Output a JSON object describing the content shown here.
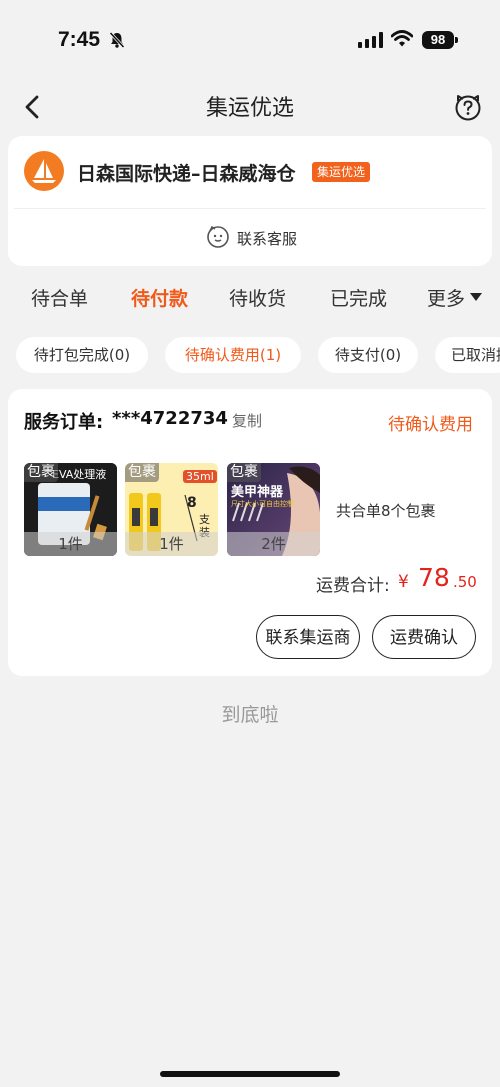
{
  "status_bar": {
    "time": "7:45",
    "battery": "98"
  },
  "nav": {
    "title": "集运优选"
  },
  "store": {
    "name": "日森国际快递–日森威海仓",
    "badge": "集运优选",
    "contact_label": "联系客服"
  },
  "tabs": [
    {
      "label": "待合单",
      "active": false
    },
    {
      "label": "待付款",
      "active": true
    },
    {
      "label": "待收货",
      "active": false
    },
    {
      "label": "已完成",
      "active": false
    },
    {
      "label": "更多",
      "active": false
    }
  ],
  "chips": [
    {
      "label": "待打包完成(0)"
    },
    {
      "label": "待确认费用(1)"
    },
    {
      "label": "待支付(0)"
    },
    {
      "label": "已取消接"
    }
  ],
  "order": {
    "label": "服务订单:",
    "number": "***4722734",
    "copy_label": "复制",
    "status": "待确认费用",
    "packages": [
      {
        "tag": "包裹",
        "qty": "1件",
        "image_text": "EVA处理液"
      },
      {
        "tag": "包裹",
        "qty": "1件",
        "image_badge": "35ml",
        "image_text_a": "8",
        "image_text_b": "支装"
      },
      {
        "tag": "包裹",
        "qty": "2件",
        "image_text": "美甲神器",
        "image_subtext": "尺寸大小可自由控制"
      }
    ],
    "summary": "共合单8个包裹",
    "total_label": "运费合计:",
    "currency": "¥",
    "total_int": "78",
    "total_dec": ".50",
    "contact_button": "联系集运商",
    "confirm_button": "运费确认"
  },
  "footer": {
    "end_text": "到底啦"
  }
}
